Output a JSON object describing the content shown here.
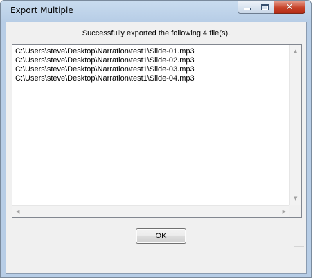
{
  "window": {
    "title": "Export Multiple",
    "close_glyph": "✕"
  },
  "dialog": {
    "message": "Successfully exported the following 4 file(s).",
    "files": [
      "C:\\Users\\steve\\Desktop\\Narration\\test1\\Slide-01.mp3",
      "C:\\Users\\steve\\Desktop\\Narration\\test1\\Slide-02.mp3",
      "C:\\Users\\steve\\Desktop\\Narration\\test1\\Slide-03.mp3",
      "C:\\Users\\steve\\Desktop\\Narration\\test1\\Slide-04.mp3"
    ],
    "ok_label": "OK"
  },
  "scrollbar_arrows": {
    "up": "▲",
    "down": "▼",
    "left": "◀",
    "right": "▶"
  },
  "icons": [
    "minimize-icon",
    "maximize-icon",
    "close-icon",
    "resize-grip-icon"
  ],
  "colors": {
    "titlebar": "#c9dcef",
    "close_button": "#c7432a",
    "client_bg": "#f0f0f0"
  }
}
